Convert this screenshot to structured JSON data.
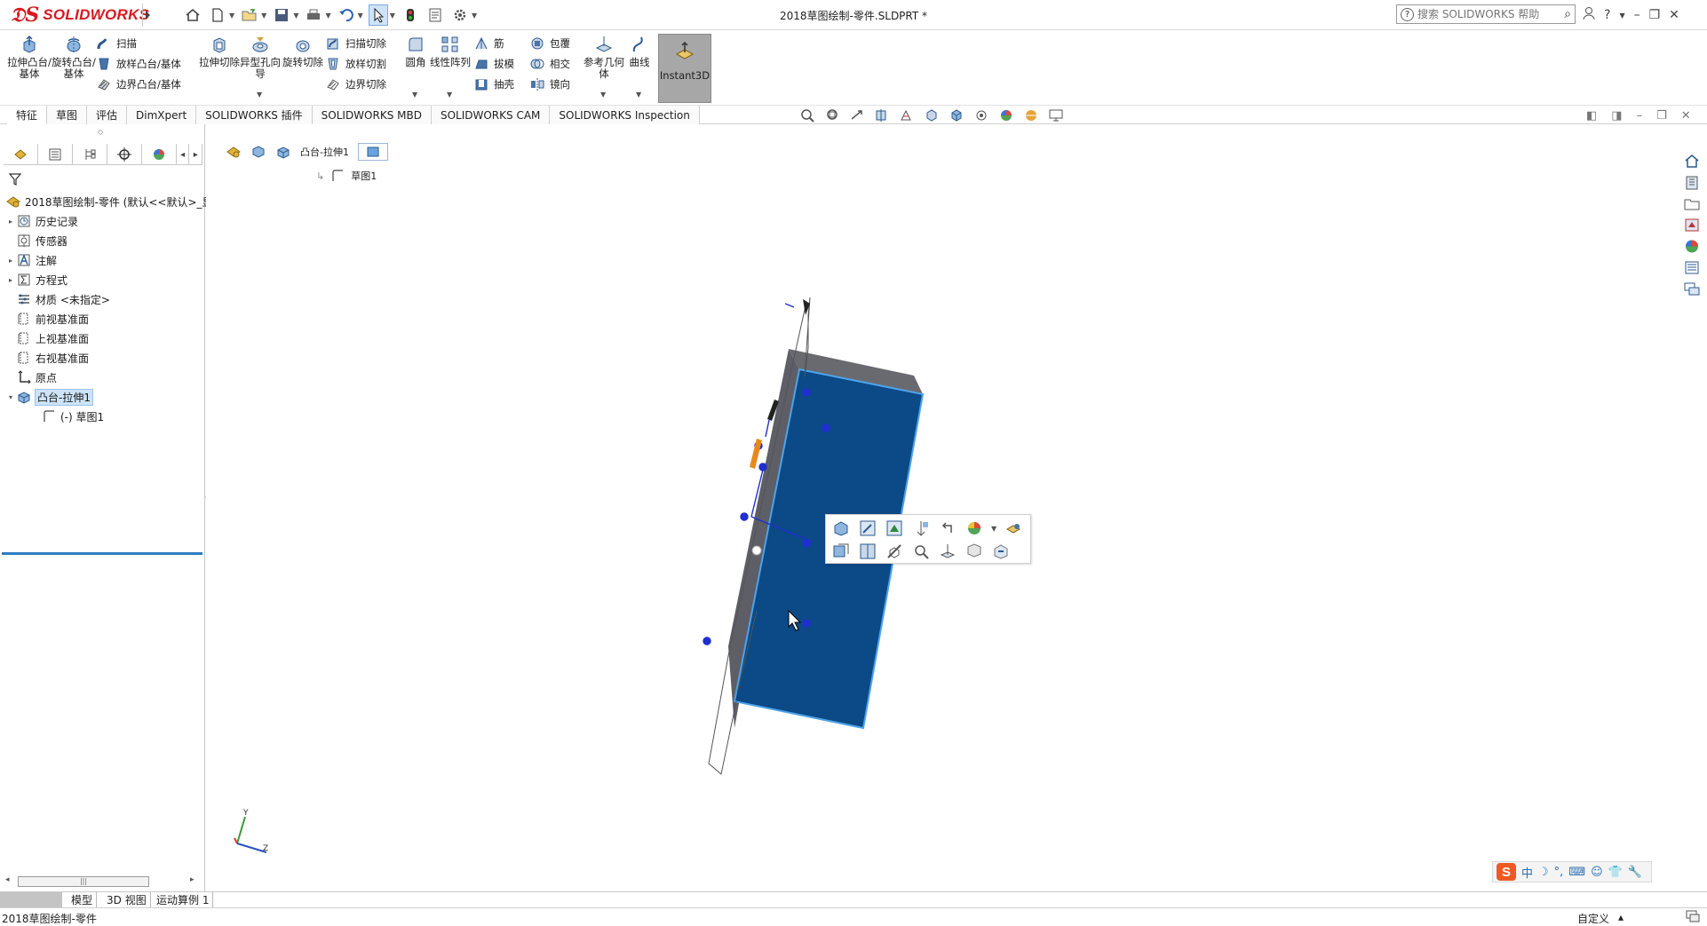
{
  "app": {
    "brand": "SOLIDWORKS",
    "document_title": "2018草图绘制-零件.SLDPRT *"
  },
  "search": {
    "placeholder": "搜索 SOLIDWORKS 帮助"
  },
  "ribbon": {
    "extrude_boss": "拉伸凸台/基体",
    "revolve_boss": "旋转凸台/基体",
    "sweep": "扫描",
    "loft_boss": "放样凸台/基体",
    "boundary_boss": "边界凸台/基体",
    "extrude_cut": "拉伸切除",
    "hole_wizard": "异型孔向导",
    "revolve_cut": "旋转切除",
    "swept_cut": "扫描切除",
    "lofted_cut": "放样切割",
    "boundary_cut": "边界切除",
    "fillet": "圆角",
    "linear_pattern": "线性阵列",
    "rib": "筋",
    "draft": "拔模",
    "shell": "抽壳",
    "wrap": "包覆",
    "intersect": "相交",
    "mirror": "镜向",
    "reference_geometry": "参考几何体",
    "curves": "曲线",
    "instant3d": "Instant3D"
  },
  "command_tabs": [
    "特征",
    "草图",
    "评估",
    "DimXpert",
    "SOLIDWORKS 插件",
    "SOLIDWORKS MBD",
    "SOLIDWORKS CAM",
    "SOLIDWORKS Inspection"
  ],
  "feature_tree": {
    "root": "2018草图绘制-零件 (默认<<默认>_显",
    "items": [
      {
        "label": "历史记录",
        "expander": "▸",
        "icon": "history-icon"
      },
      {
        "label": "传感器",
        "expander": "",
        "icon": "sensor-icon"
      },
      {
        "label": "注解",
        "expander": "▸",
        "icon": "annotation-icon"
      },
      {
        "label": "方程式",
        "expander": "▸",
        "icon": "equation-icon"
      },
      {
        "label": "材质 <未指定>",
        "expander": "",
        "icon": "material-icon"
      },
      {
        "label": "前视基准面",
        "expander": "",
        "icon": "plane-icon"
      },
      {
        "label": "上视基准面",
        "expander": "",
        "icon": "plane-icon"
      },
      {
        "label": "右视基准面",
        "expander": "",
        "icon": "plane-icon"
      },
      {
        "label": "原点",
        "expander": "",
        "icon": "origin-icon"
      },
      {
        "label": "凸台-拉伸1",
        "expander": "▾",
        "icon": "extrude-icon",
        "selected": true
      },
      {
        "label": "(-) 草图1",
        "expander": "",
        "icon": "sketch-icon",
        "child": true
      }
    ]
  },
  "breadcrumb": {
    "feature": "凸台-拉伸1",
    "child": "草图1"
  },
  "bottom_tabs": [
    "模型",
    "3D 视图",
    "运动算例 1"
  ],
  "status": {
    "left": "2018草图绘制-零件",
    "right": "自定义",
    "right_caret": "▴"
  },
  "ime": {
    "logo": "S",
    "mode": "中"
  },
  "colors": {
    "brand_red": "#d71920",
    "face_selected": "#0b4a86",
    "face_edge_highlight": "#4ea3ea",
    "body_side": "#5f6068",
    "body_top": "#6b6c73",
    "sketch_blue": "#1f2fd0",
    "instant3d_bg": "#a7a7a7",
    "tree_selection": "#cde4f7"
  }
}
